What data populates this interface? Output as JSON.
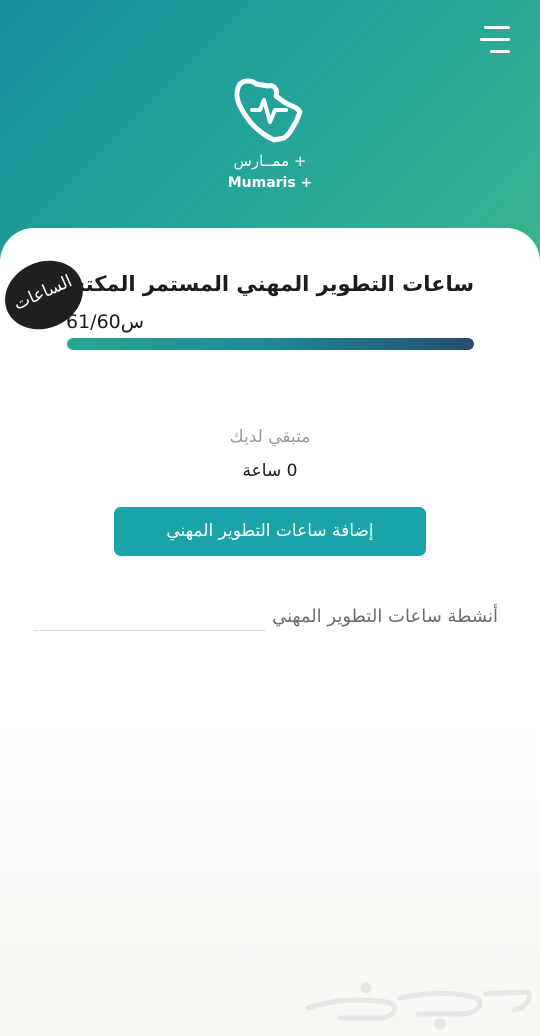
{
  "app": {
    "name_ar": "ممــارس +",
    "name_en": "Mumaris +",
    "brand_color": "#178f9a",
    "accent_color": "#1aa3a8"
  },
  "header": {
    "menu_icon": "hamburger-menu-icon",
    "logo_icon": "mumaris-heartbeat-logo-icon"
  },
  "cpd": {
    "title": "ساعات التطوير المهني المستمر المكتسب",
    "hours_text": "61/60س",
    "progress": 1.0
  },
  "annotation": {
    "text": "الساعات"
  },
  "remaining": {
    "label": "متبقي لديك",
    "value": "0 ساعة"
  },
  "actions": {
    "add_button_label": "إضافة ساعات التطوير المهني"
  },
  "activities": {
    "label": "أنشطة ساعات التطوير المهني"
  },
  "watermark": {
    "text": "حراج"
  }
}
